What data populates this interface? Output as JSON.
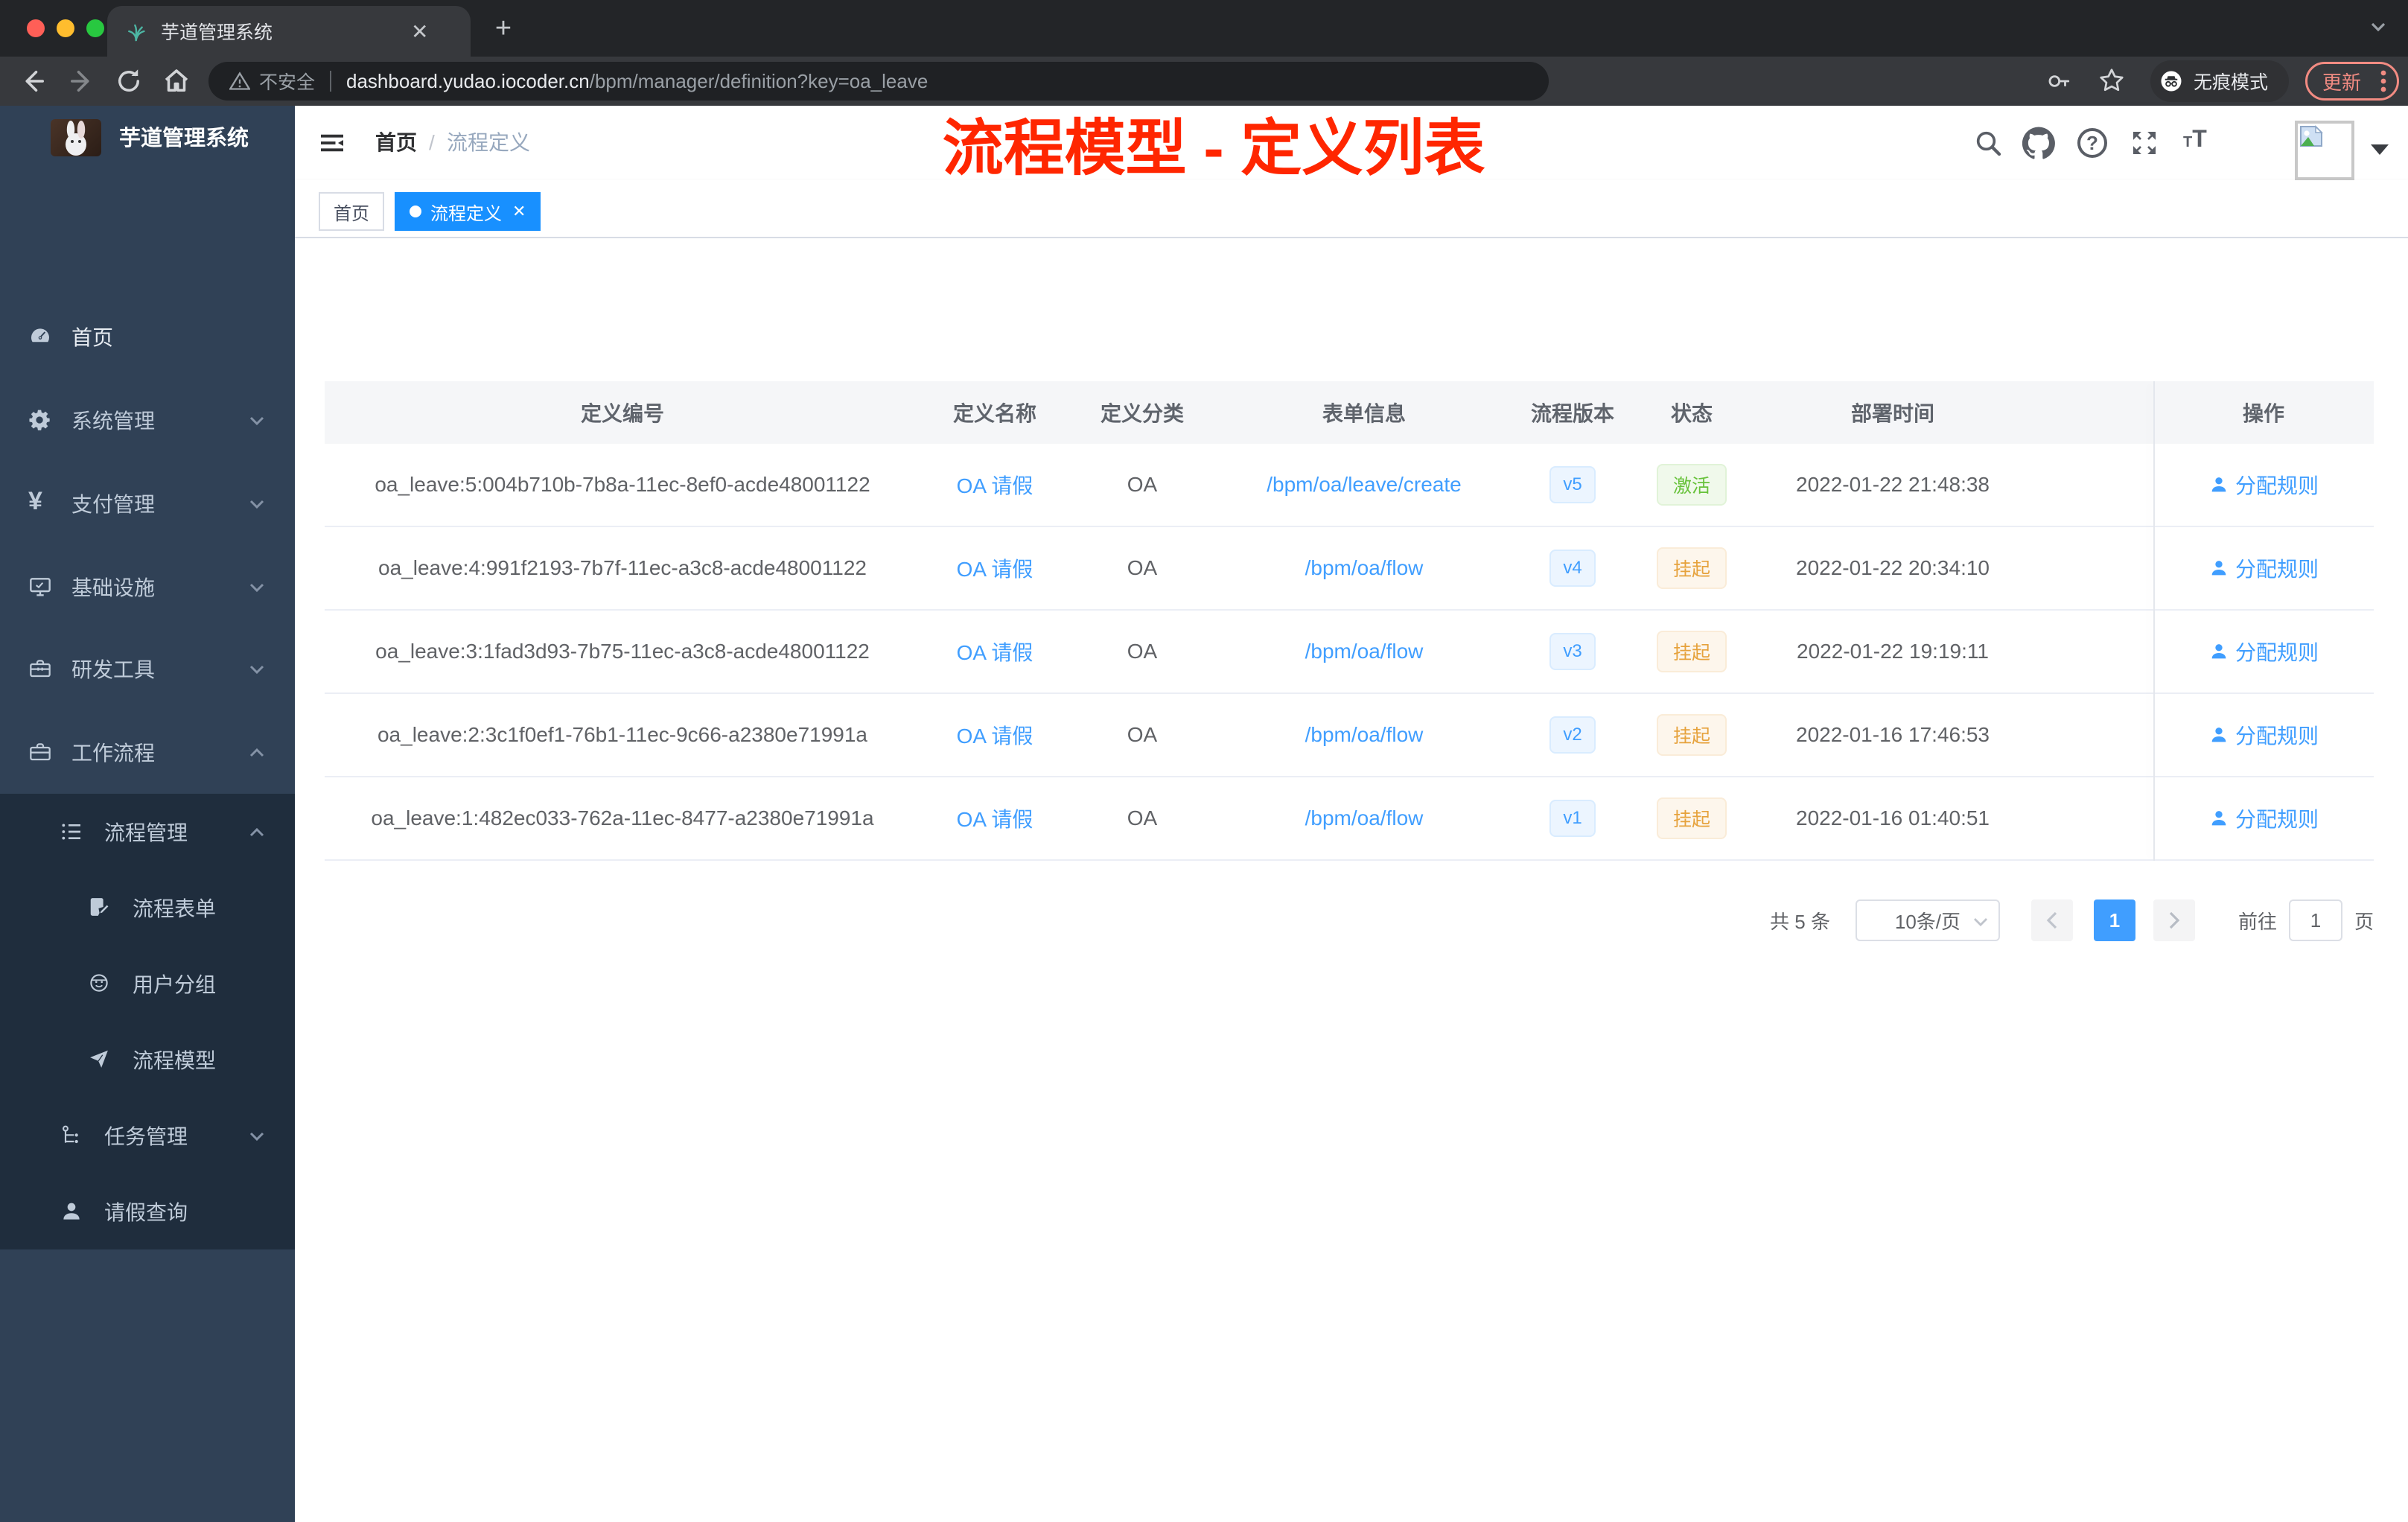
{
  "browser": {
    "tab_title": "芋道管理系统",
    "new_tab_label": "+",
    "close_tab_label": "✕",
    "security_label": "不安全",
    "url_host": "dashboard.yudao.iocoder.cn",
    "url_path": "/bpm/manager/definition?key=oa_leave",
    "incognito_label": "无痕模式",
    "update_label": "更新"
  },
  "sidebar": {
    "title": "芋道管理系统",
    "items": [
      {
        "label": "首页"
      },
      {
        "label": "系统管理"
      },
      {
        "label": "支付管理"
      },
      {
        "label": "基础设施"
      },
      {
        "label": "研发工具"
      },
      {
        "label": "工作流程"
      }
    ],
    "sub_items": [
      {
        "label": "流程管理"
      },
      {
        "label": "流程表单"
      },
      {
        "label": "用户分组"
      },
      {
        "label": "流程模型"
      },
      {
        "label": "任务管理"
      },
      {
        "label": "请假查询"
      }
    ]
  },
  "header": {
    "breadcrumb_home": "首页",
    "breadcrumb_sep": "/",
    "breadcrumb_current": "流程定义",
    "annotation": "流程模型 - 定义列表"
  },
  "tags": {
    "home": "首页",
    "active": "流程定义",
    "close": "✕"
  },
  "table": {
    "columns": [
      "定义编号",
      "定义名称",
      "定义分类",
      "表单信息",
      "流程版本",
      "状态",
      "部署时间",
      "操作"
    ],
    "rows": [
      {
        "id": "oa_leave:5:004b710b-7b8a-11ec-8ef0-acde48001122",
        "name": "OA 请假",
        "category": "OA",
        "form": "/bpm/oa/leave/create",
        "version": "v5",
        "status": "激活",
        "time": "2022-01-22 21:48:38",
        "action": "分配规则"
      },
      {
        "id": "oa_leave:4:991f2193-7b7f-11ec-a3c8-acde48001122",
        "name": "OA 请假",
        "category": "OA",
        "form": "/bpm/oa/flow",
        "version": "v4",
        "status": "挂起",
        "time": "2022-01-22 20:34:10",
        "action": "分配规则"
      },
      {
        "id": "oa_leave:3:1fad3d93-7b75-11ec-a3c8-acde48001122",
        "name": "OA 请假",
        "category": "OA",
        "form": "/bpm/oa/flow",
        "version": "v3",
        "status": "挂起",
        "time": "2022-01-22 19:19:11",
        "action": "分配规则"
      },
      {
        "id": "oa_leave:2:3c1f0ef1-76b1-11ec-9c66-a2380e71991a",
        "name": "OA 请假",
        "category": "OA",
        "form": "/bpm/oa/flow",
        "version": "v2",
        "status": "挂起",
        "time": "2022-01-16 17:46:53",
        "action": "分配规则"
      },
      {
        "id": "oa_leave:1:482ec033-762a-11ec-8477-a2380e71991a",
        "name": "OA 请假",
        "category": "OA",
        "form": "/bpm/oa/flow",
        "version": "v1",
        "status": "挂起",
        "time": "2022-01-16 01:40:51",
        "action": "分配规则"
      }
    ]
  },
  "pagination": {
    "total": "共 5 条",
    "page_size": "10条/页",
    "current_page": "1",
    "goto_label": "前往",
    "goto_value": "1",
    "page_unit": "页"
  },
  "colors": {
    "primary": "#409eff",
    "active_tag": "#1890ff",
    "annotation_red": "#ff2600",
    "success": "#67c23a",
    "warning": "#e6a23c",
    "sidebar_bg": "#304156",
    "submenu_bg": "#1f2d3d"
  }
}
